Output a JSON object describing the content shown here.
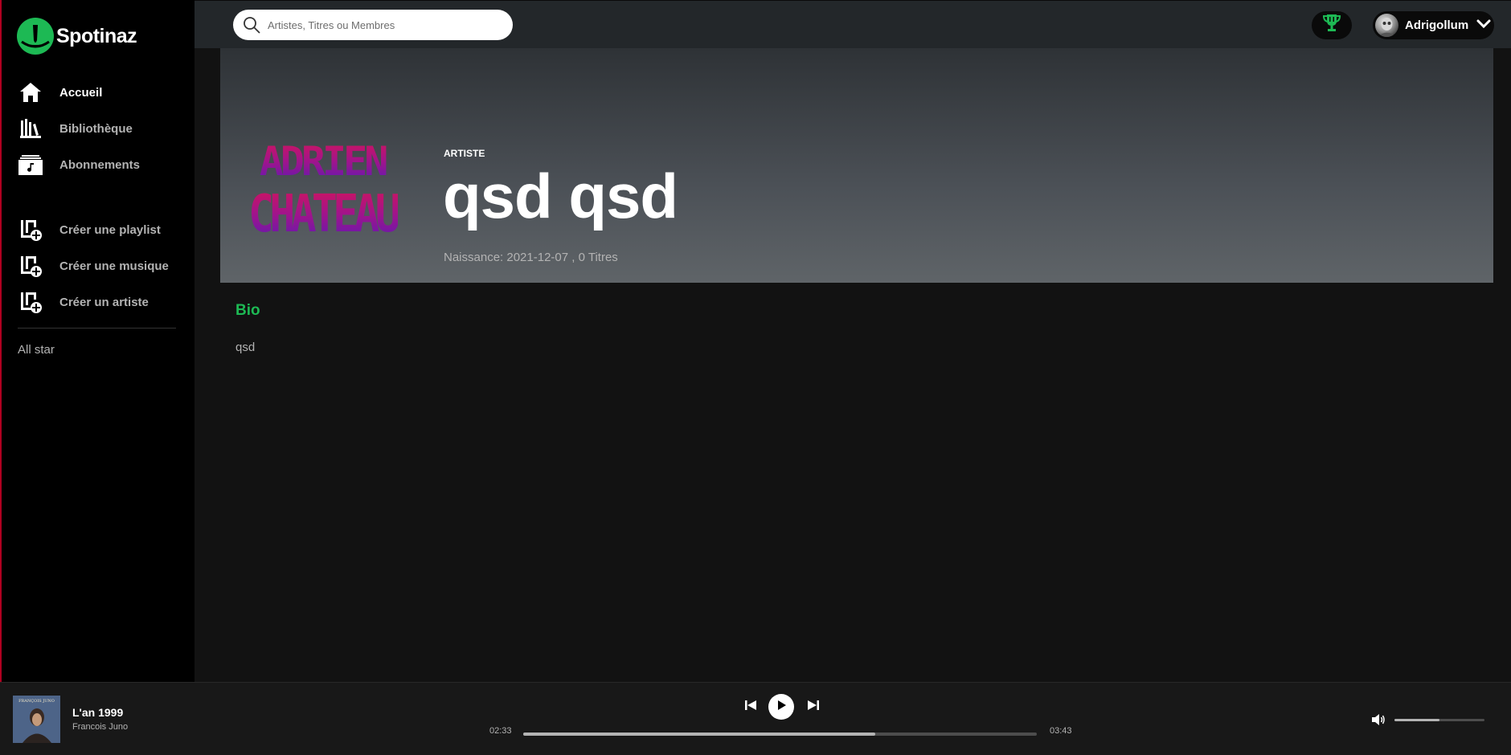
{
  "app": {
    "name": "Spotinaz",
    "accent_color": "#1db954"
  },
  "sidebar": {
    "main_items": [
      {
        "label": "Accueil",
        "icon": "home-icon"
      },
      {
        "label": "Bibliothèque",
        "icon": "library-icon"
      },
      {
        "label": "Abonnements",
        "icon": "subscriptions-icon"
      }
    ],
    "create_items": [
      {
        "label": "Créer une playlist",
        "icon": "add-playlist-icon"
      },
      {
        "label": "Créer une musique",
        "icon": "add-music-icon"
      },
      {
        "label": "Créer un artiste",
        "icon": "add-artist-icon"
      }
    ],
    "playlists": [
      "All star"
    ]
  },
  "header": {
    "search_placeholder": "Artistes, Titres ou Membres",
    "user_name": "Adrigollum",
    "trophy_icon": "trophy-icon"
  },
  "artist": {
    "type_label": "ARTISTE",
    "name": "qsd qsd",
    "meta": "Naissance: 2021-12-07 , 0 Titres",
    "image_text_line1": "ADRIEN",
    "image_text_line2": "CHATEAU"
  },
  "bio": {
    "title": "Bio",
    "text": "qsd"
  },
  "player": {
    "track_title": "L'an 1999",
    "track_artist": "Francois Juno",
    "cover_text": "FRANÇOIS JUNO",
    "current_time": "02:33",
    "total_time": "03:43",
    "progress_fraction": 0.686,
    "volume_fraction": 0.5
  }
}
